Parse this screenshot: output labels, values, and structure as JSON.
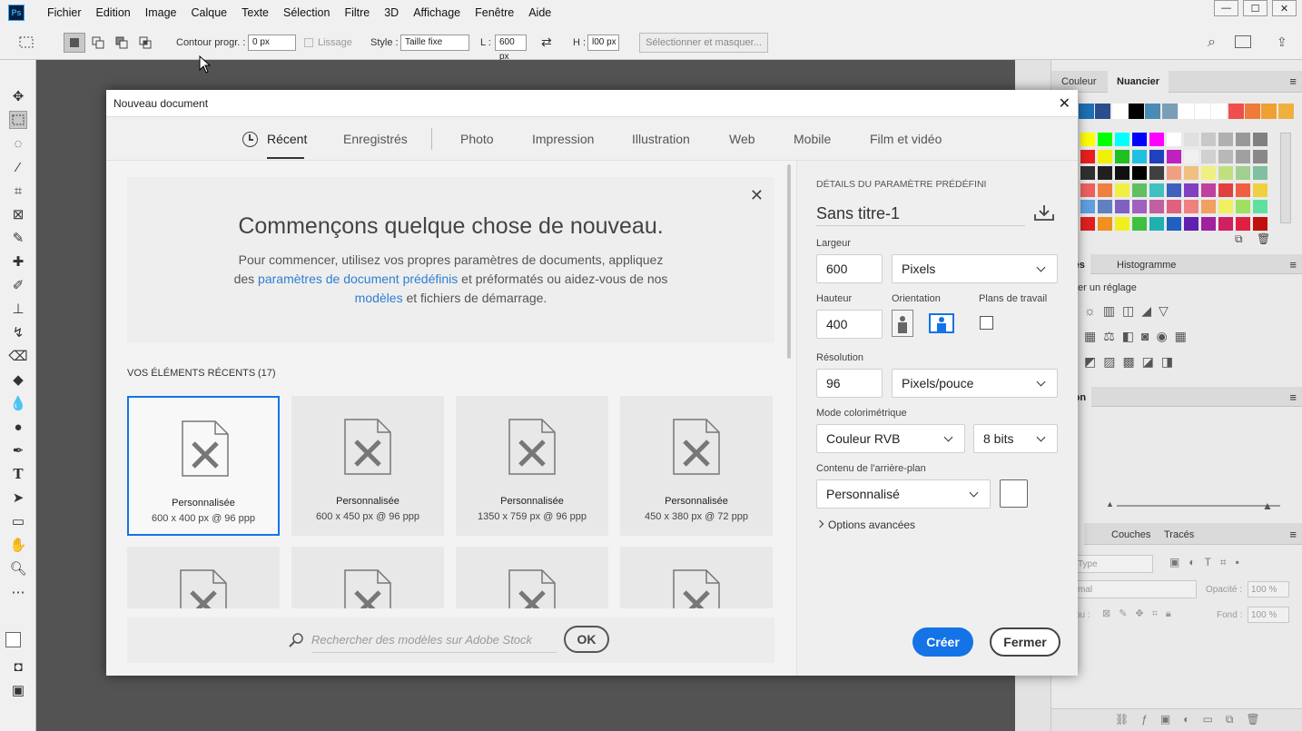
{
  "app": {
    "logo": "Ps"
  },
  "menubar": {
    "items": [
      "Fichier",
      "Edition",
      "Image",
      "Calque",
      "Texte",
      "Sélection",
      "Filtre",
      "3D",
      "Affichage",
      "Fenêtre",
      "Aide"
    ]
  },
  "window_controls": {
    "minimize": "—",
    "maximize": "☐",
    "close": "✕"
  },
  "options_bar": {
    "feather_label": "Contour progr. :",
    "feather_value": "0 px",
    "antialias_label": "Lissage",
    "style_label": "Style :",
    "style_value": "Taille fixe",
    "width_label": "L :",
    "width_value": "600 px",
    "height_label": "H :",
    "height_value": "l00 px",
    "select_mask_label": "Sélectionner et masquer..."
  },
  "right_panel": {
    "tabs_top": [
      "Couleur",
      "Nuancier"
    ],
    "adjustments_tab": "glages",
    "histogram_tab": "Histogramme",
    "add_adjustment": "ter un réglage",
    "navigation_tab": "igation",
    "layers_tabs": [
      "ques",
      "Couches",
      "Tracés"
    ],
    "kind_label": "Type",
    "blend_label": "mal",
    "opacity_label": "Opacité :",
    "opacity_value": "100 %",
    "lock_label": "ou :",
    "fill_label": "Fond :",
    "fill_value": "100 %",
    "swatch_colors": {
      "row1": [
        "#1e6fb5",
        "#2a4d8c",
        "#ffffff",
        "#000000",
        "#4a8bb5",
        "#7a9eb8",
        "#ffffff",
        "#ffffff",
        "#ffffff",
        "#f04e4e",
        "#f07a3a",
        "#f0a030",
        "#f0b040"
      ],
      "row2": [
        "#ffff00",
        "#00ff00",
        "#00ffff",
        "#0000ff",
        "#ff00ff",
        "#ffffff",
        "#e0e0e0",
        "#c8c8c8",
        "#b0b0b0",
        "#989898",
        "#808080"
      ],
      "row3": [
        "#e82020",
        "#f0f000",
        "#20c020",
        "#20c0e0",
        "#2040c0",
        "#c020c0",
        "#f0f0f0",
        "#d0d0d0",
        "#b8b8b8",
        "#a0a0a0",
        "#888888"
      ],
      "row4": [
        "#303030",
        "#202020",
        "#101010",
        "#000000",
        "#404040",
        "#f0a080",
        "#f0c080",
        "#f0f080",
        "#c0e080",
        "#a0d090",
        "#80c0a0"
      ],
      "row5": [
        "#f06060",
        "#f08040",
        "#f0f040",
        "#60c060",
        "#40c0c0",
        "#4060c0",
        "#8040c0",
        "#c040a0",
        "#e04040",
        "#f06040",
        "#f0d040"
      ],
      "row6": [
        "#60a0e0",
        "#6080c0",
        "#8060c0",
        "#a060c0",
        "#c060a0",
        "#e06080",
        "#f08080",
        "#f0a060",
        "#f0f060",
        "#a0e060",
        "#60e0a0"
      ],
      "row7": [
        "#e02020",
        "#f09020",
        "#f0f020",
        "#40c040",
        "#20b0b0",
        "#2060c0",
        "#6020b0",
        "#a020a0",
        "#d02060",
        "#e02040",
        "#c01010"
      ]
    }
  },
  "dialog": {
    "title": "Nouveau document",
    "close": "✕",
    "tabs": [
      "Récent",
      "Enregistrés",
      "Photo",
      "Impression",
      "Illustration",
      "Web",
      "Mobile",
      "Film et vidéo"
    ],
    "welcome": {
      "heading": "Commençons quelque chose de nouveau.",
      "line1": "Pour commencer, utilisez vos propres paramètres de documents, appliquez",
      "line2_pre": "des ",
      "line2_link": "paramètres de document prédéfinis",
      "line2_post": " et préformatés ou aidez-vous de nos",
      "line3_link": "modèles",
      "line3_post": " et fichiers de démarrage.",
      "close": "✕"
    },
    "recent_label": "VOS ÉLÉMENTS RÉCENTS",
    "recent_count": "(17)",
    "recent_items": [
      {
        "name": "Personnalisée",
        "size": "600 x 400 px @ 96 ppp"
      },
      {
        "name": "Personnalisée",
        "size": "600 x 450 px @ 96 ppp"
      },
      {
        "name": "Personnalisée",
        "size": "1350 x 759 px @ 96 ppp"
      },
      {
        "name": "Personnalisée",
        "size": "450 x 380 px @ 72 ppp"
      }
    ],
    "search_placeholder": "Rechercher des modèles sur Adobe Stock",
    "search_ok": "OK",
    "details": {
      "header": "DÉTAILS DU PARAMÈTRE PRÉDÉFINI",
      "name": "Sans titre-1",
      "width_label": "Largeur",
      "width_value": "600",
      "width_unit": "Pixels",
      "height_label": "Hauteur",
      "height_value": "400",
      "orientation_label": "Orientation",
      "artboards_label": "Plans de travail",
      "resolution_label": "Résolution",
      "resolution_value": "96",
      "resolution_unit": "Pixels/pouce",
      "color_mode_label": "Mode colorimétrique",
      "color_mode_value": "Couleur RVB",
      "bit_depth": "8 bits",
      "background_label": "Contenu de l'arrière-plan",
      "background_value": "Personnalisé",
      "advanced_label": "Options avancées"
    },
    "create_button": "Créer",
    "close_button": "Fermer"
  },
  "colors": {
    "accent": "#1473e6",
    "link": "#2d7fd3"
  }
}
